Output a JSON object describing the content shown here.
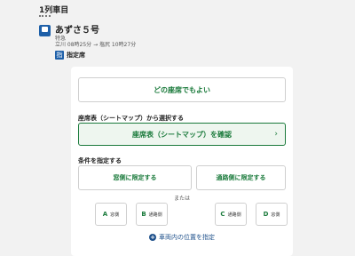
{
  "train": {
    "car_label": "1列車目",
    "name": "あずさ５号",
    "type": "特急",
    "time": "立川 08時25分 → 塩尻 10時27分",
    "seat_icon_char": "指",
    "seat_class": "指定席"
  },
  "seat_selection": {
    "any_seat_label": "どの座席でもよい",
    "map_section_label": "座席表（シートマップ）から選択する",
    "map_button_label": "座席表（シートマップ）を確認",
    "chevron": "›",
    "condition_section_label": "条件を指定する",
    "window_label": "窓側に限定する",
    "aisle_label": "通路側に限定する",
    "or_text": "または",
    "seats": [
      {
        "letter": "A",
        "kind": "窓側"
      },
      {
        "letter": "B",
        "kind": "通路側"
      },
      {
        "letter": "C",
        "kind": "通路側"
      },
      {
        "letter": "D",
        "kind": "窓側"
      }
    ],
    "position_link": "車両内の位置を指定",
    "plus_icon_char": "+"
  },
  "colors": {
    "accent_green": "#1a7a3b",
    "accent_blue": "#1d5fa8"
  }
}
